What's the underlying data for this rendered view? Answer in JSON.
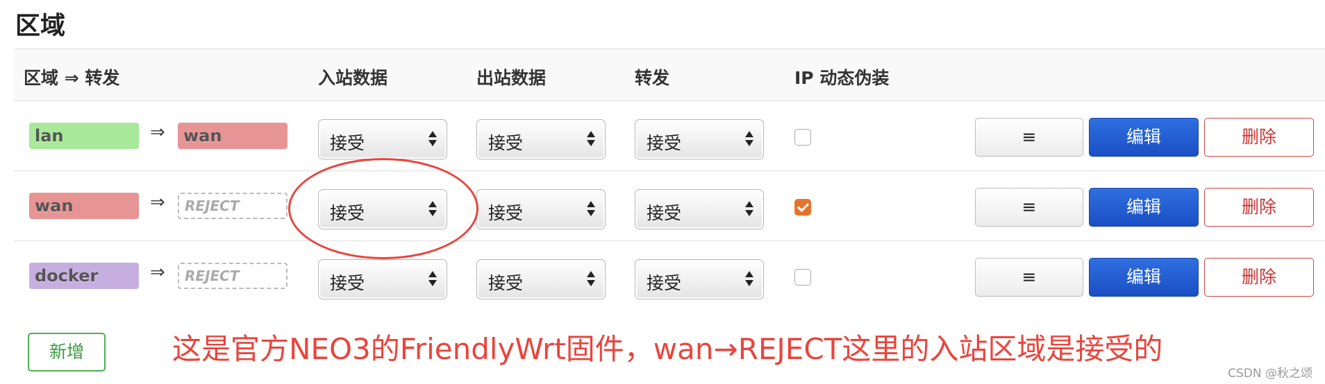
{
  "section_title": "区域",
  "headers": {
    "zone_forward": "区域 ⇒ 转发",
    "input": "入站数据",
    "output": "出站数据",
    "forward": "转发",
    "masq": "IP 动态伪装"
  },
  "arrow": "⇒",
  "rows": [
    {
      "zone": "lan",
      "dest": "wan",
      "input": "接受",
      "output": "接受",
      "forward": "接受",
      "masq": false
    },
    {
      "zone": "wan",
      "dest": "REJECT",
      "input": "接受",
      "output": "接受",
      "forward": "接受",
      "masq": true
    },
    {
      "zone": "docker",
      "dest": "REJECT",
      "input": "接受",
      "output": "接受",
      "forward": "接受",
      "masq": false
    }
  ],
  "buttons": {
    "menu": "≡",
    "edit": "编辑",
    "delete": "删除",
    "add": "新增"
  },
  "annotation": "这是官方NEO3的FriendlyWrt固件，wan→REJECT这里的入站区域是接受的",
  "watermark": "CSDN @秋之颂",
  "colors": {
    "lan": "#a8e89a",
    "wan": "#e69494",
    "docker": "#c6afe0",
    "edit": "#1a4fc4",
    "annotation": "#e8453c",
    "checkbox": "#e7732a"
  },
  "icons": {
    "select_caret": "updown-caret-icon",
    "menu": "hamburger-icon",
    "check": "checkmark-icon"
  }
}
